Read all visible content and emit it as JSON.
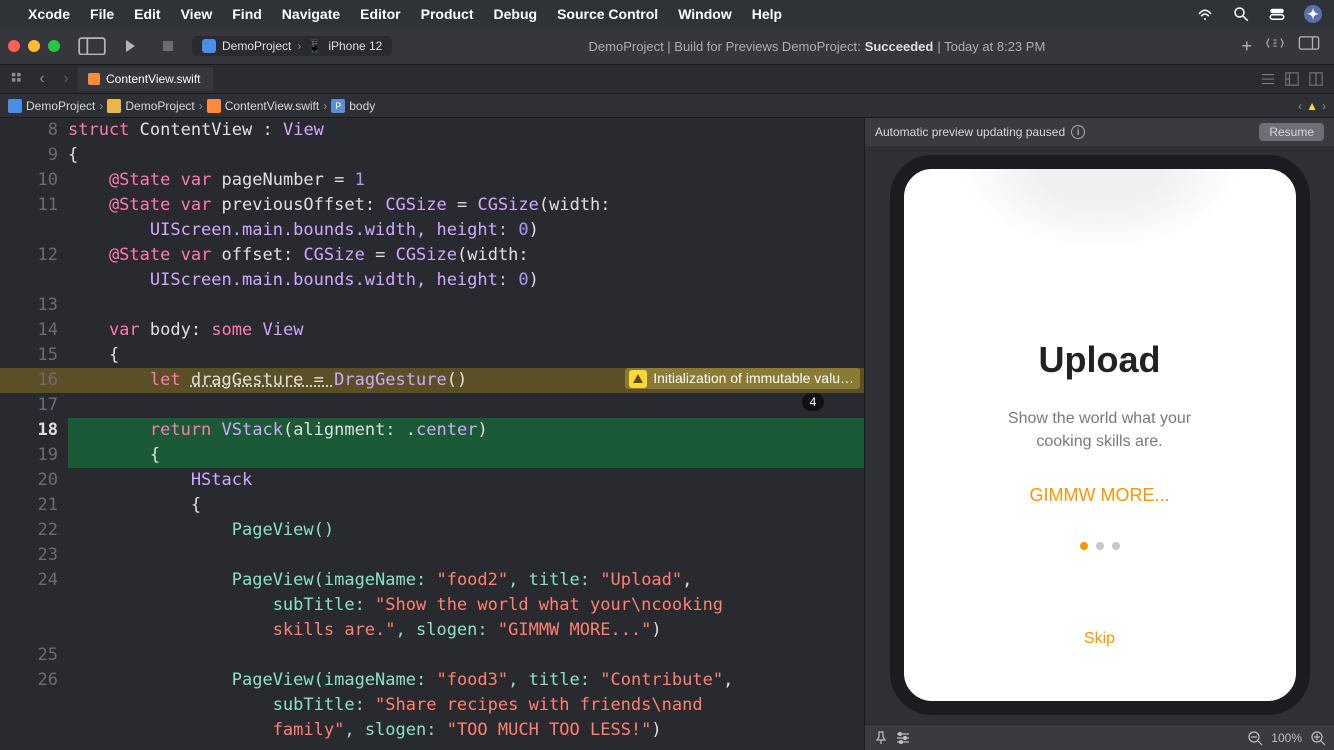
{
  "menubar": {
    "app": "Xcode",
    "items": [
      "File",
      "Edit",
      "View",
      "Find",
      "Navigate",
      "Editor",
      "Product",
      "Debug",
      "Source Control",
      "Window",
      "Help"
    ]
  },
  "toolbar": {
    "scheme_project": "DemoProject",
    "scheme_device": "iPhone 12",
    "status_prefix": "DemoProject | Build for Previews DemoProject: ",
    "status_result": "Succeeded",
    "status_time": " | Today at 8:23 PM"
  },
  "tab": {
    "filename": "ContentView.swift"
  },
  "breadcrumb": {
    "p0": "DemoProject",
    "p1": "DemoProject",
    "p2": "ContentView.swift",
    "p3": "body"
  },
  "code": {
    "l8_a": "struct ",
    "l8_b": "ContentView ",
    "l8_c": ": ",
    "l8_d": "View",
    "l9": "{",
    "l10_a": "    @State ",
    "l10_b": "var ",
    "l10_c": "pageNumber = ",
    "l10_d": "1",
    "l11_a": "    @State ",
    "l11_b": "var ",
    "l11_c": "previousOffset: ",
    "l11_d": "CGSize ",
    "l11_e": "= ",
    "l11_f": "CGSize",
    "l11_g": "(width:",
    "l11b": "        UIScreen.main.bounds.width, height: ",
    "l11b_num": "0",
    "l11b_end": ")",
    "l12_a": "    @State ",
    "l12_b": "var ",
    "l12_c": "offset: ",
    "l12_d": "CGSize ",
    "l12_e": "= ",
    "l12_f": "CGSize",
    "l12_g": "(width:",
    "l12b": "        UIScreen.main.bounds.width, height: ",
    "l12b_num": "0",
    "l12b_end": ")",
    "l14_a": "    var ",
    "l14_b": "body: ",
    "l14_c": "some ",
    "l14_d": "View",
    "l15": "    {",
    "l16_a": "        let ",
    "l16_b": "dragGesture = ",
    "l16_c": "DragGesture",
    "l16_d": "()",
    "l18_a": "        return ",
    "l18_b": "VStack",
    "l18_c": "(alignment: .",
    "l18_d": "center",
    "l18_e": ")",
    "l19": "        {",
    "l20": "            HStack",
    "l21": "            {",
    "l22": "                PageView()",
    "l24_a": "                PageView(imageName: ",
    "l24_b": "\"food2\"",
    "l24_c": ", title: ",
    "l24_d": "\"Upload\"",
    "l24_e": ",",
    "l24b_a": "                    subTitle: ",
    "l24b_b": "\"Show the world what your\\ncooking",
    "l24c_a": "                    skills are.\"",
    "l24c_b": ", slogen: ",
    "l24c_c": "\"GIMMW MORE...\"",
    "l24c_d": ")",
    "l26_a": "                PageView(imageName: ",
    "l26_b": "\"food3\"",
    "l26_c": ", title: ",
    "l26_d": "\"Contribute\"",
    "l26_e": ",",
    "l26b_a": "                    subTitle: ",
    "l26b_b": "\"Share recipes with friends\\nand",
    "l26c_a": "                    family\"",
    "l26c_b": ", slogen: ",
    "l26c_c": "\"TOO MUCH TOO LESS!\"",
    "l26c_d": ")"
  },
  "gutter": {
    "g8": "8",
    "g9": "9",
    "g10": "10",
    "g11": "11",
    "g12": "12",
    "g13": "13",
    "g14": "14",
    "g15": "15",
    "g16": "16",
    "g17": "17",
    "g18": "18",
    "g19": "19",
    "g20": "20",
    "g21": "21",
    "g22": "22",
    "g23": "23",
    "g24": "24",
    "g25": "25",
    "g26": "26"
  },
  "warning": {
    "text": "Initialization of immutable valu…",
    "fold_count": "4"
  },
  "preview": {
    "paused": "Automatic preview updating paused",
    "resume": "Resume",
    "title": "Upload",
    "subtitle": "Show the world what your\ncooking skills are.",
    "slogan": "GIMMW MORE...",
    "skip": "Skip",
    "zoom": "100%"
  }
}
